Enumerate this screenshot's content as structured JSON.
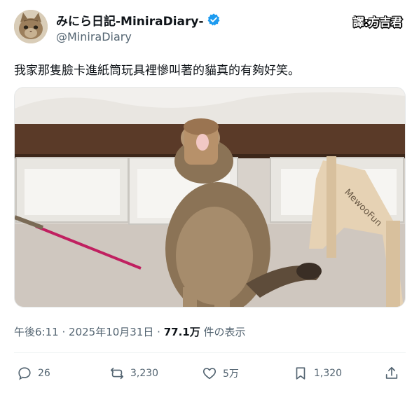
{
  "post": {
    "display_name": "みにら日記-MiniraDiary-",
    "handle": "@MiniraDiary",
    "verified": true,
    "watermark": "譯:方吉君",
    "text": "我家那隻臉卡進紙筒玩具裡慘叫著的貓真的有夠好笑。",
    "image": {
      "description_icon": "cat-photo",
      "brand_text": "MewooFun"
    },
    "meta": {
      "time": "午後6:11",
      "sep1": "·",
      "date": "2025年10月31日",
      "sep2": "·",
      "views": "77.1万",
      "views_suffix": "件の表示"
    },
    "actions": {
      "reply_count": "26",
      "repost_count": "3,230",
      "like_count": "5万",
      "bookmark_count": "1,320"
    }
  },
  "colors": {
    "text_primary": "#0f1419",
    "text_secondary": "#536471",
    "verified_blue": "#1d9bf0",
    "divider": "#eff3f4"
  }
}
